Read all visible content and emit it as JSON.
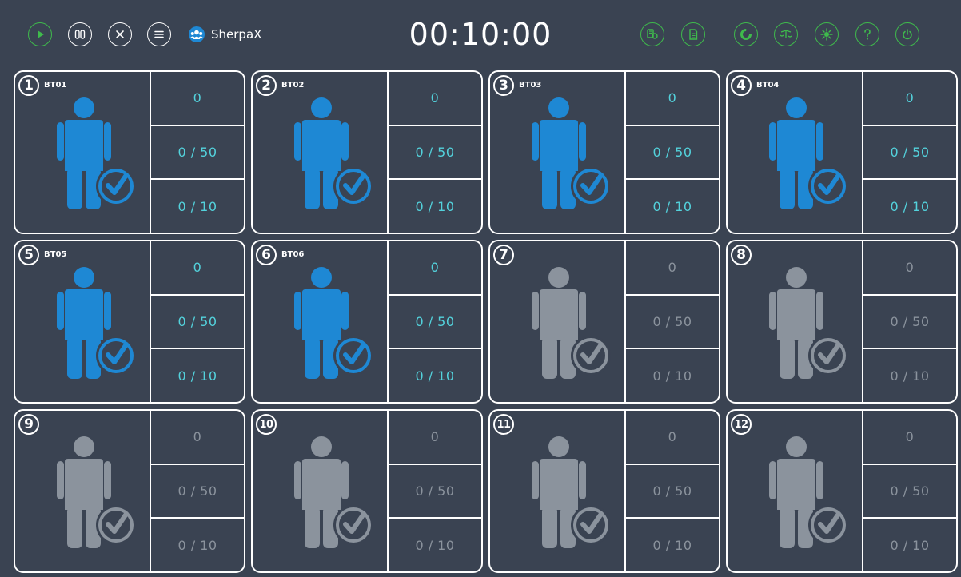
{
  "toolbar": {
    "app_name": "SherpaX",
    "timer": "00:10:00",
    "left_icons": [
      "play-icon",
      "pause-icon",
      "stop-icon",
      "menu-icon",
      "team-icon"
    ],
    "right_icons": [
      "device-search-icon",
      "report-icon",
      "progress-icon",
      "calibrate-icon",
      "sensor-icon",
      "help-icon",
      "power-icon"
    ]
  },
  "colors": {
    "background": "#3a4352",
    "active_accent": "#1e88d4",
    "active_text": "#53d2dc",
    "inactive": "#8b939d",
    "toolbar_green": "#3fba4c"
  },
  "cards": [
    {
      "number": "1",
      "device_id": "BT01",
      "active": true,
      "value1": "0",
      "value2": "0 / 50",
      "value3": "0 / 10"
    },
    {
      "number": "2",
      "device_id": "BT02",
      "active": true,
      "value1": "0",
      "value2": "0 / 50",
      "value3": "0 / 10"
    },
    {
      "number": "3",
      "device_id": "BT03",
      "active": true,
      "value1": "0",
      "value2": "0 / 50",
      "value3": "0 / 10"
    },
    {
      "number": "4",
      "device_id": "BT04",
      "active": true,
      "value1": "0",
      "value2": "0 / 50",
      "value3": "0 / 10"
    },
    {
      "number": "5",
      "device_id": "BT05",
      "active": true,
      "value1": "0",
      "value2": "0 / 50",
      "value3": "0 / 10"
    },
    {
      "number": "6",
      "device_id": "BT06",
      "active": true,
      "value1": "0",
      "value2": "0 / 50",
      "value3": "0 / 10"
    },
    {
      "number": "7",
      "device_id": "",
      "active": false,
      "value1": "0",
      "value2": "0 / 50",
      "value3": "0 / 10"
    },
    {
      "number": "8",
      "device_id": "",
      "active": false,
      "value1": "0",
      "value2": "0 / 50",
      "value3": "0 / 10"
    },
    {
      "number": "9",
      "device_id": "",
      "active": false,
      "value1": "0",
      "value2": "0 / 50",
      "value3": "0 / 10"
    },
    {
      "number": "10",
      "device_id": "",
      "active": false,
      "value1": "0",
      "value2": "0 / 50",
      "value3": "0 / 10"
    },
    {
      "number": "11",
      "device_id": "",
      "active": false,
      "value1": "0",
      "value2": "0 / 50",
      "value3": "0 / 10"
    },
    {
      "number": "12",
      "device_id": "",
      "active": false,
      "value1": "0",
      "value2": "0 / 50",
      "value3": "0 / 10"
    }
  ]
}
